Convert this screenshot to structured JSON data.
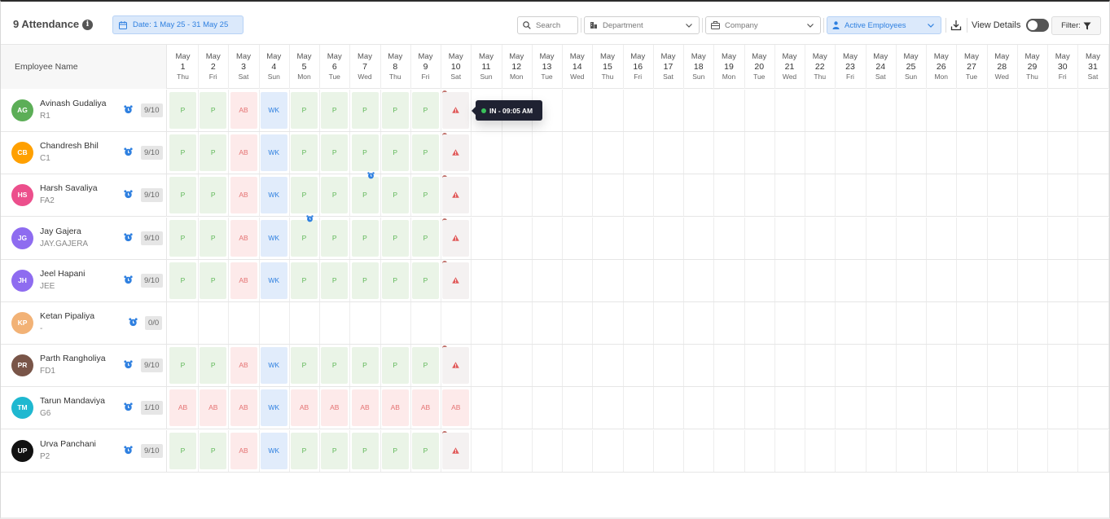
{
  "header": {
    "title": "9 Attendance",
    "date_range": "Date: 1 May 25 - 31 May 25",
    "search_placeholder": "Search",
    "department_placeholder": "Department",
    "company_placeholder": "Company",
    "employee_filter": "Active Employees",
    "view_details_label": "View Details",
    "filter_label": "Filter:"
  },
  "table": {
    "name_header": "Employee Name",
    "days": [
      {
        "m": "May",
        "d": "1",
        "w": "Thu"
      },
      {
        "m": "May",
        "d": "2",
        "w": "Fri"
      },
      {
        "m": "May",
        "d": "3",
        "w": "Sat"
      },
      {
        "m": "May",
        "d": "4",
        "w": "Sun"
      },
      {
        "m": "May",
        "d": "5",
        "w": "Mon"
      },
      {
        "m": "May",
        "d": "6",
        "w": "Tue"
      },
      {
        "m": "May",
        "d": "7",
        "w": "Wed"
      },
      {
        "m": "May",
        "d": "8",
        "w": "Thu"
      },
      {
        "m": "May",
        "d": "9",
        "w": "Fri"
      },
      {
        "m": "May",
        "d": "10",
        "w": "Sat"
      },
      {
        "m": "May",
        "d": "11",
        "w": "Sun"
      },
      {
        "m": "May",
        "d": "12",
        "w": "Mon"
      },
      {
        "m": "May",
        "d": "13",
        "w": "Tue"
      },
      {
        "m": "May",
        "d": "14",
        "w": "Wed"
      },
      {
        "m": "May",
        "d": "15",
        "w": "Thu"
      },
      {
        "m": "May",
        "d": "16",
        "w": "Fri"
      },
      {
        "m": "May",
        "d": "17",
        "w": "Sat"
      },
      {
        "m": "May",
        "d": "18",
        "w": "Sun"
      },
      {
        "m": "May",
        "d": "19",
        "w": "Mon"
      },
      {
        "m": "May",
        "d": "20",
        "w": "Tue"
      },
      {
        "m": "May",
        "d": "21",
        "w": "Wed"
      },
      {
        "m": "May",
        "d": "22",
        "w": "Thu"
      },
      {
        "m": "May",
        "d": "23",
        "w": "Fri"
      },
      {
        "m": "May",
        "d": "24",
        "w": "Sat"
      },
      {
        "m": "May",
        "d": "25",
        "w": "Sun"
      },
      {
        "m": "May",
        "d": "26",
        "w": "Mon"
      },
      {
        "m": "May",
        "d": "27",
        "w": "Tue"
      },
      {
        "m": "May",
        "d": "28",
        "w": "Wed"
      },
      {
        "m": "May",
        "d": "29",
        "w": "Thu"
      },
      {
        "m": "May",
        "d": "30",
        "w": "Fri"
      },
      {
        "m": "May",
        "d": "31",
        "w": "Sat"
      }
    ]
  },
  "employees": [
    {
      "initials": "AG",
      "name": "Avinash Gudaliya",
      "code": "R1",
      "count": "9/10",
      "color": "#5cae57",
      "att": [
        "P",
        "P",
        "AB",
        "WK",
        "P",
        "P",
        "P",
        "P",
        "P",
        "ALERT"
      ],
      "alarm_on": []
    },
    {
      "initials": "CB",
      "name": "Chandresh Bhil",
      "code": "C1",
      "count": "9/10",
      "color": "#ffa000",
      "att": [
        "P",
        "P",
        "AB",
        "WK",
        "P",
        "P",
        "P",
        "P",
        "P",
        "ALERT"
      ],
      "alarm_on": []
    },
    {
      "initials": "HS",
      "name": "Harsh Savaliya",
      "code": "FA2",
      "count": "9/10",
      "color": "#ec4f8c",
      "att": [
        "P",
        "P",
        "AB",
        "WK",
        "P",
        "P",
        "P",
        "P",
        "P",
        "ALERT"
      ],
      "alarm_on": [
        6
      ]
    },
    {
      "initials": "JG",
      "name": "Jay Gajera",
      "code": "JAY.GAJERA",
      "count": "9/10",
      "color": "#8e6cf0",
      "att": [
        "P",
        "P",
        "AB",
        "WK",
        "P",
        "P",
        "P",
        "P",
        "P",
        "ALERT"
      ],
      "alarm_on": [
        4
      ]
    },
    {
      "initials": "JH",
      "name": "Jeel Hapani",
      "code": "JEE",
      "count": "9/10",
      "color": "#8e6cf0",
      "att": [
        "P",
        "P",
        "AB",
        "WK",
        "P",
        "P",
        "P",
        "P",
        "P",
        "ALERT"
      ],
      "alarm_on": []
    },
    {
      "initials": "KP",
      "name": "Ketan Pipaliya",
      "code": "-",
      "count": "0/0",
      "color": "#f2b276",
      "att": [],
      "alarm_on": []
    },
    {
      "initials": "PR",
      "name": "Parth Rangholiya",
      "code": "FD1",
      "count": "9/10",
      "color": "#795548",
      "att": [
        "P",
        "P",
        "AB",
        "WK",
        "P",
        "P",
        "P",
        "P",
        "P",
        "ALERT"
      ],
      "alarm_on": []
    },
    {
      "initials": "TM",
      "name": "Tarun Mandaviya",
      "code": "G6",
      "count": "1/10",
      "color": "#1fb8d0",
      "att": [
        "AB",
        "AB",
        "AB",
        "WK",
        "AB",
        "AB",
        "AB",
        "AB",
        "AB",
        "AB"
      ],
      "alarm_on": []
    },
    {
      "initials": "UP",
      "name": "Urva Panchani",
      "code": "P2",
      "count": "9/10",
      "color": "#111111",
      "att": [
        "P",
        "P",
        "AB",
        "WK",
        "P",
        "P",
        "P",
        "P",
        "P",
        "ALERT"
      ],
      "alarm_on": []
    }
  ],
  "tooltip": {
    "text": "IN - 09:05 AM"
  },
  "colors": {
    "accent": "#2f80e0",
    "present": "#61b85a",
    "absent": "#e57373",
    "weekend": "#2f80e0"
  }
}
